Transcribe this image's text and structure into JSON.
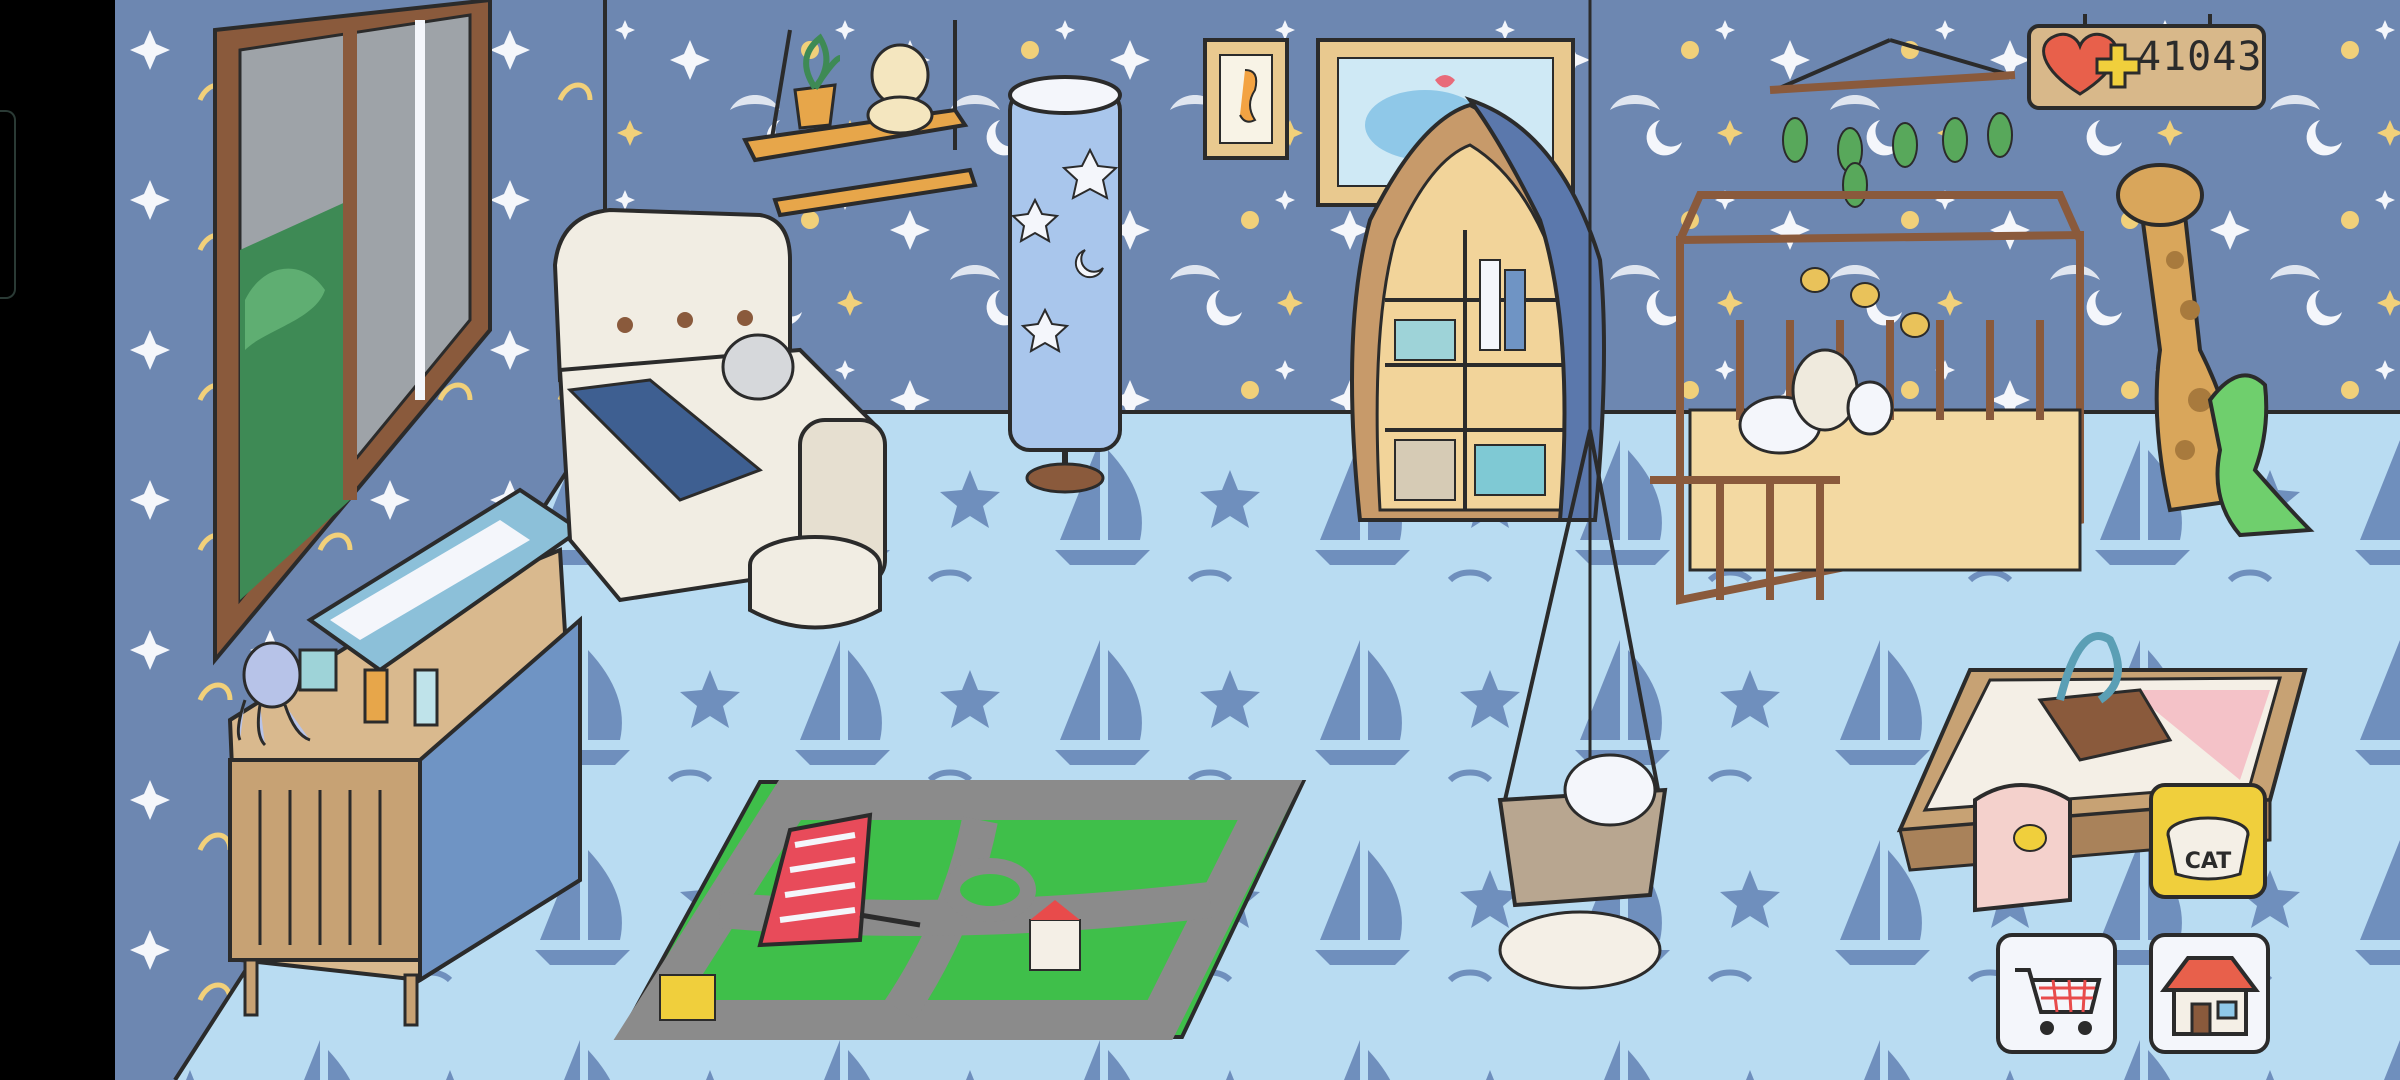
{
  "hud": {
    "hearts": {
      "value": "41043",
      "icon": "heart-plus-icon"
    },
    "buttons": {
      "cat_food": {
        "icon": "cat-bowl-icon",
        "label": "CAT"
      },
      "shop": {
        "icon": "shopping-cart-icon"
      },
      "home": {
        "icon": "house-icon"
      }
    }
  },
  "room": {
    "furniture": [
      "window",
      "changing-table",
      "octopus-plush",
      "armchair",
      "ottoman",
      "hanging-shelf",
      "star-floor-lamp",
      "seahorse-frame",
      "whale-frame",
      "boat-bookshelf",
      "baby-mobile",
      "crib",
      "giraffe-plush",
      "dino-plush",
      "hanging-cradle",
      "play-rug",
      "xylophone",
      "activity-table",
      "duck-stool"
    ]
  },
  "colors": {
    "wall": "#6d87b1",
    "floor": "#b9dcf2",
    "wood": "#a9825a",
    "rug_green": "#3fbf4a",
    "rug_road": "#8b8b8b",
    "ui_gold": "#f0cf3c"
  }
}
